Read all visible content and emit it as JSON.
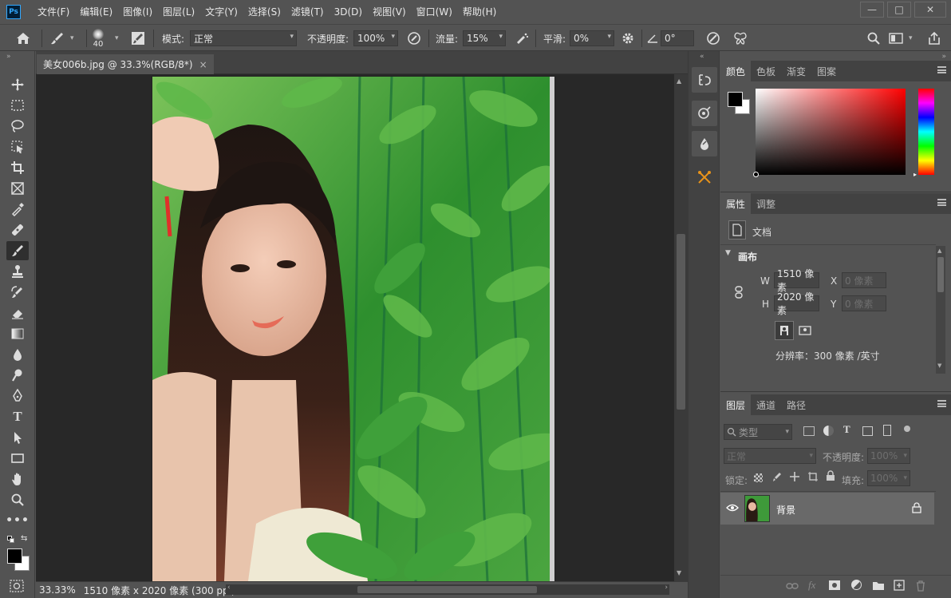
{
  "app": {
    "logo": "Ps"
  },
  "menu": [
    "文件(F)",
    "编辑(E)",
    "图像(I)",
    "图层(L)",
    "文字(Y)",
    "选择(S)",
    "滤镜(T)",
    "3D(D)",
    "视图(V)",
    "窗口(W)",
    "帮助(H)"
  ],
  "window_controls": {
    "minimize": "—",
    "maximize": "□",
    "close": "✕"
  },
  "options": {
    "brush_size": "40",
    "mode_label": "模式:",
    "mode_value": "正常",
    "opacity_label": "不透明度:",
    "opacity_value": "100%",
    "flow_label": "流量:",
    "flow_value": "15%",
    "smooth_label": "平滑:",
    "smooth_value": "0%",
    "angle_value": "0°"
  },
  "document": {
    "tab_title": "美女006b.jpg @ 33.3%(RGB/8*)",
    "close": "×"
  },
  "status": {
    "zoom": "33.33%",
    "info": "1510 像素 x 2020 像素 (300 ppi)"
  },
  "color_panel": {
    "tabs": [
      "颜色",
      "色板",
      "渐变",
      "图案"
    ]
  },
  "properties_panel": {
    "tabs": [
      "属性",
      "调整"
    ],
    "doc_label": "文档",
    "section": "画布",
    "w_label": "W",
    "w_value": "1510 像素",
    "h_label": "H",
    "h_value": "2020 像素",
    "x_label": "X",
    "x_value": "0 像素",
    "y_label": "Y",
    "y_value": "0 像素",
    "resolution": "分辨率：300 像素 /英寸"
  },
  "layers_panel": {
    "tabs": [
      "图层",
      "通道",
      "路径"
    ],
    "filter_placeholder": "类型",
    "blend_mode": "正常",
    "opacity_label": "不透明度:",
    "opacity_value": "100%",
    "lock_label": "锁定:",
    "fill_label": "填充:",
    "fill_value": "100%",
    "layer_name": "背景"
  },
  "colors": {
    "foreground": "#000000",
    "background": "#ffffff",
    "hue": "#ff0000"
  }
}
